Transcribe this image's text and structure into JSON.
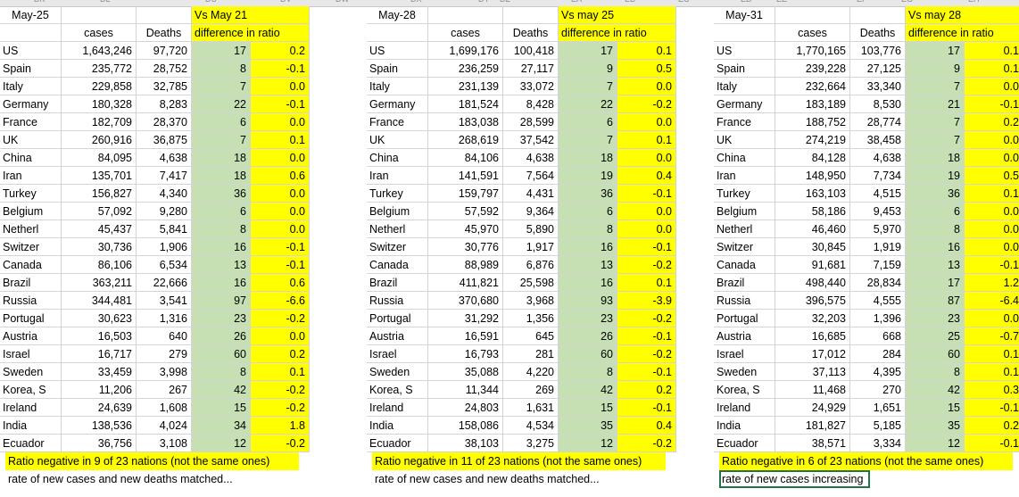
{
  "column_header_fragments": [
    "DK",
    "DL",
    "DU",
    "DV",
    "DW",
    "DX",
    "DY",
    "DZ",
    "EA",
    "EB",
    "EC",
    "ED",
    "EE",
    "EF",
    "EG",
    "EH"
  ],
  "colors": {
    "ratio_fill": "#c6e0b4",
    "highlight_fill": "#ffff00",
    "gridline": "#d4d4d4"
  },
  "blocks": [
    {
      "date": "May-25",
      "vs_label": "Vs May 21",
      "cases_header": "cases",
      "deaths_header": "Deaths",
      "diff_header": "difference in ratio",
      "rows": [
        {
          "country": "US",
          "cases": "1,643,246",
          "deaths": "97,720",
          "ratio": "17",
          "diff": "0.2"
        },
        {
          "country": "Spain",
          "cases": "235,772",
          "deaths": "28,752",
          "ratio": "8",
          "diff": "-0.1"
        },
        {
          "country": "Italy",
          "cases": "229,858",
          "deaths": "32,785",
          "ratio": "7",
          "diff": "0.0"
        },
        {
          "country": "Germany",
          "cases": "180,328",
          "deaths": "8,283",
          "ratio": "22",
          "diff": "-0.1"
        },
        {
          "country": "France",
          "cases": "182,709",
          "deaths": "28,370",
          "ratio": "6",
          "diff": "0.0"
        },
        {
          "country": "UK",
          "cases": "260,916",
          "deaths": "36,875",
          "ratio": "7",
          "diff": "0.1"
        },
        {
          "country": "China",
          "cases": "84,095",
          "deaths": "4,638",
          "ratio": "18",
          "diff": "0.0"
        },
        {
          "country": "Iran",
          "cases": "135,701",
          "deaths": "7,417",
          "ratio": "18",
          "diff": "0.6"
        },
        {
          "country": "Turkey",
          "cases": "156,827",
          "deaths": "4,340",
          "ratio": "36",
          "diff": "0.0"
        },
        {
          "country": "Belgium",
          "cases": "57,092",
          "deaths": "9,280",
          "ratio": "6",
          "diff": "0.0"
        },
        {
          "country": "Netherl",
          "cases": "45,437",
          "deaths": "5,841",
          "ratio": "8",
          "diff": "0.0"
        },
        {
          "country": "Switzer",
          "cases": "30,736",
          "deaths": "1,906",
          "ratio": "16",
          "diff": "-0.1"
        },
        {
          "country": "Canada",
          "cases": "86,106",
          "deaths": "6,534",
          "ratio": "13",
          "diff": "-0.1"
        },
        {
          "country": "Brazil",
          "cases": "363,211",
          "deaths": "22,666",
          "ratio": "16",
          "diff": "0.6"
        },
        {
          "country": "Russia",
          "cases": "344,481",
          "deaths": "3,541",
          "ratio": "97",
          "diff": "-6.6"
        },
        {
          "country": "Portugal",
          "cases": "30,623",
          "deaths": "1,316",
          "ratio": "23",
          "diff": "-0.2"
        },
        {
          "country": "Austria",
          "cases": "16,503",
          "deaths": "640",
          "ratio": "26",
          "diff": "0.0"
        },
        {
          "country": "Israel",
          "cases": "16,717",
          "deaths": "279",
          "ratio": "60",
          "diff": "0.2"
        },
        {
          "country": "Sweden",
          "cases": "33,459",
          "deaths": "3,998",
          "ratio": "8",
          "diff": "0.1"
        },
        {
          "country": "Korea, S",
          "cases": "11,206",
          "deaths": "267",
          "ratio": "42",
          "diff": "-0.2"
        },
        {
          "country": "Ireland",
          "cases": "24,639",
          "deaths": "1,608",
          "ratio": "15",
          "diff": "-0.2"
        },
        {
          "country": "India",
          "cases": "138,536",
          "deaths": "4,024",
          "ratio": "34",
          "diff": "1.8"
        },
        {
          "country": "Ecuador",
          "cases": "36,756",
          "deaths": "3,108",
          "ratio": "12",
          "diff": "-0.2"
        }
      ],
      "note1": "Ratio  negative in 9 of 23 nations (not the same ones)",
      "note2": "rate of new cases and new deaths matched..."
    },
    {
      "date": "May-28",
      "vs_label": "Vs may 25",
      "cases_header": "cases",
      "deaths_header": "Deaths",
      "diff_header": "difference in ratio",
      "rows": [
        {
          "country": "US",
          "cases": "1,699,176",
          "deaths": "100,418",
          "ratio": "17",
          "diff": "0.1"
        },
        {
          "country": "Spain",
          "cases": "236,259",
          "deaths": "27,117",
          "ratio": "9",
          "diff": "0.5"
        },
        {
          "country": "Italy",
          "cases": "231,139",
          "deaths": "33,072",
          "ratio": "7",
          "diff": "0.0"
        },
        {
          "country": "Germany",
          "cases": "181,524",
          "deaths": "8,428",
          "ratio": "22",
          "diff": "-0.2"
        },
        {
          "country": "France",
          "cases": "183,038",
          "deaths": "28,599",
          "ratio": "6",
          "diff": "0.0"
        },
        {
          "country": "UK",
          "cases": "268,619",
          "deaths": "37,542",
          "ratio": "7",
          "diff": "0.1"
        },
        {
          "country": "China",
          "cases": "84,106",
          "deaths": "4,638",
          "ratio": "18",
          "diff": "0.0"
        },
        {
          "country": "Iran",
          "cases": "141,591",
          "deaths": "7,564",
          "ratio": "19",
          "diff": "0.4"
        },
        {
          "country": "Turkey",
          "cases": "159,797",
          "deaths": "4,431",
          "ratio": "36",
          "diff": "-0.1"
        },
        {
          "country": "Belgium",
          "cases": "57,592",
          "deaths": "9,364",
          "ratio": "6",
          "diff": "0.0"
        },
        {
          "country": "Netherl",
          "cases": "45,970",
          "deaths": "5,890",
          "ratio": "8",
          "diff": "0.0"
        },
        {
          "country": "Switzer",
          "cases": "30,776",
          "deaths": "1,917",
          "ratio": "16",
          "diff": "-0.1"
        },
        {
          "country": "Canada",
          "cases": "88,989",
          "deaths": "6,876",
          "ratio": "13",
          "diff": "-0.2"
        },
        {
          "country": "Brazil",
          "cases": "411,821",
          "deaths": "25,598",
          "ratio": "16",
          "diff": "0.1"
        },
        {
          "country": "Russia",
          "cases": "370,680",
          "deaths": "3,968",
          "ratio": "93",
          "diff": "-3.9"
        },
        {
          "country": "Portugal",
          "cases": "31,292",
          "deaths": "1,356",
          "ratio": "23",
          "diff": "-0.2"
        },
        {
          "country": "Austria",
          "cases": "16,591",
          "deaths": "645",
          "ratio": "26",
          "diff": "-0.1"
        },
        {
          "country": "Israel",
          "cases": "16,793",
          "deaths": "281",
          "ratio": "60",
          "diff": "-0.2"
        },
        {
          "country": "Sweden",
          "cases": "35,088",
          "deaths": "4,220",
          "ratio": "8",
          "diff": "-0.1"
        },
        {
          "country": "Korea, S",
          "cases": "11,344",
          "deaths": "269",
          "ratio": "42",
          "diff": "0.2"
        },
        {
          "country": "Ireland",
          "cases": "24,803",
          "deaths": "1,631",
          "ratio": "15",
          "diff": "-0.1"
        },
        {
          "country": "India",
          "cases": "158,086",
          "deaths": "4,534",
          "ratio": "35",
          "diff": "0.4"
        },
        {
          "country": "Ecuador",
          "cases": "38,103",
          "deaths": "3,275",
          "ratio": "12",
          "diff": "-0.2"
        }
      ],
      "note1": "Ratio  negative in 11 of 23 nations (not the same ones)",
      "note2": "rate of new cases and new deaths matched..."
    },
    {
      "date": "May-31",
      "vs_label": "Vs may 28",
      "cases_header": "cases",
      "deaths_header": "Deaths",
      "diff_header": "difference in ratio",
      "rows": [
        {
          "country": "US",
          "cases": "1,770,165",
          "deaths": "103,776",
          "ratio": "17",
          "diff": "0.1"
        },
        {
          "country": "Spain",
          "cases": "239,228",
          "deaths": "27,125",
          "ratio": "9",
          "diff": "0.1"
        },
        {
          "country": "Italy",
          "cases": "232,664",
          "deaths": "33,340",
          "ratio": "7",
          "diff": "0.0"
        },
        {
          "country": "Germany",
          "cases": "183,189",
          "deaths": "8,530",
          "ratio": "21",
          "diff": "-0.1"
        },
        {
          "country": "France",
          "cases": "188,752",
          "deaths": "28,774",
          "ratio": "7",
          "diff": "0.2"
        },
        {
          "country": "UK",
          "cases": "274,219",
          "deaths": "38,458",
          "ratio": "7",
          "diff": "0.0"
        },
        {
          "country": "China",
          "cases": "84,128",
          "deaths": "4,638",
          "ratio": "18",
          "diff": "0.0"
        },
        {
          "country": "Iran",
          "cases": "148,950",
          "deaths": "7,734",
          "ratio": "19",
          "diff": "0.5"
        },
        {
          "country": "Turkey",
          "cases": "163,103",
          "deaths": "4,515",
          "ratio": "36",
          "diff": "0.1"
        },
        {
          "country": "Belgium",
          "cases": "58,186",
          "deaths": "9,453",
          "ratio": "6",
          "diff": "0.0"
        },
        {
          "country": "Netherl",
          "cases": "46,460",
          "deaths": "5,970",
          "ratio": "8",
          "diff": "0.0"
        },
        {
          "country": "Switzer",
          "cases": "30,845",
          "deaths": "1,919",
          "ratio": "16",
          "diff": "0.0"
        },
        {
          "country": "Canada",
          "cases": "91,681",
          "deaths": "7,159",
          "ratio": "13",
          "diff": "-0.1"
        },
        {
          "country": "Brazil",
          "cases": "498,440",
          "deaths": "28,834",
          "ratio": "17",
          "diff": "1.2"
        },
        {
          "country": "Russia",
          "cases": "396,575",
          "deaths": "4,555",
          "ratio": "87",
          "diff": "-6.4"
        },
        {
          "country": "Portugal",
          "cases": "32,203",
          "deaths": "1,396",
          "ratio": "23",
          "diff": "0.0"
        },
        {
          "country": "Austria",
          "cases": "16,685",
          "deaths": "668",
          "ratio": "25",
          "diff": "-0.7"
        },
        {
          "country": "Israel",
          "cases": "17,012",
          "deaths": "284",
          "ratio": "60",
          "diff": "0.1"
        },
        {
          "country": "Sweden",
          "cases": "37,113",
          "deaths": "4,395",
          "ratio": "8",
          "diff": "0.1"
        },
        {
          "country": "Korea, S",
          "cases": "11,468",
          "deaths": "270",
          "ratio": "42",
          "diff": "0.3"
        },
        {
          "country": "Ireland",
          "cases": "24,929",
          "deaths": "1,651",
          "ratio": "15",
          "diff": "-0.1"
        },
        {
          "country": "India",
          "cases": "181,827",
          "deaths": "5,185",
          "ratio": "35",
          "diff": "0.2"
        },
        {
          "country": "Ecuador",
          "cases": "38,571",
          "deaths": "3,334",
          "ratio": "12",
          "diff": "-0.1"
        }
      ],
      "note1": "Ratio  negative in 6 of 23 nations (not the same ones)",
      "note2": "rate of new cases increasing"
    }
  ]
}
